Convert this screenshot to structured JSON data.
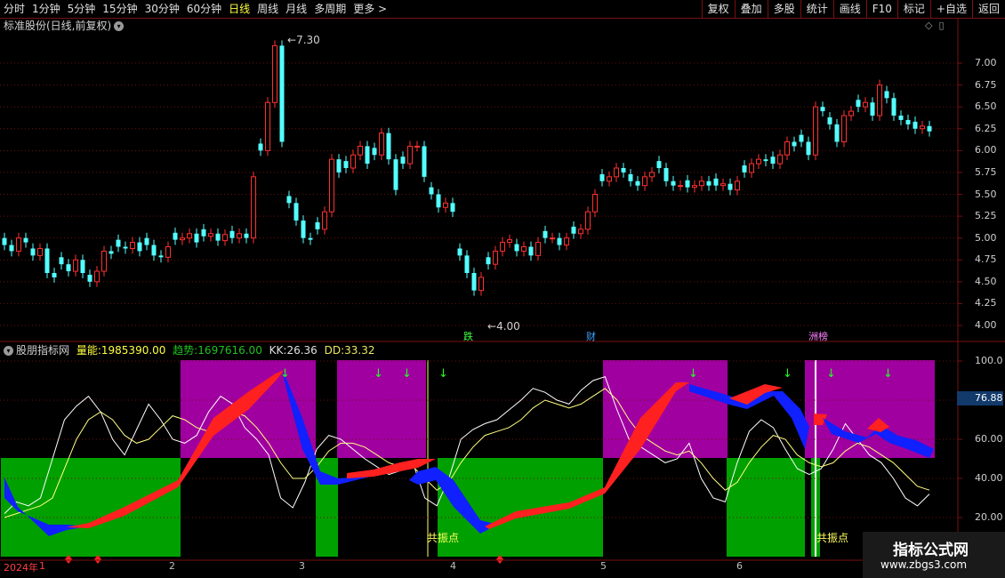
{
  "toolbar": {
    "periods": [
      "分时",
      "1分钟",
      "5分钟",
      "15分钟",
      "30分钟",
      "60分钟",
      "日线",
      "周线",
      "月线",
      "多周期",
      "更多 >"
    ],
    "active_period": "日线",
    "actions": [
      "复权",
      "叠加",
      "多股",
      "统计",
      "画线",
      "F10",
      "标记",
      "+自选",
      "返回"
    ]
  },
  "main_chart": {
    "title": "标准股份(日线,前复权)",
    "price_axis": [
      "7.00",
      "6.75",
      "6.50",
      "6.25",
      "6.00",
      "5.75",
      "5.50",
      "5.25",
      "5.00",
      "4.75",
      "4.50",
      "4.25",
      "4.00"
    ],
    "high_label": "7.30",
    "low_label": "4.00",
    "markers": [
      "跌",
      "财",
      "洲榜"
    ]
  },
  "indicator": {
    "name": "股朋指标网",
    "volume_label": "量能:",
    "volume_value": "1985390.00",
    "trend_label": "趋势:",
    "trend_value": "1697616.00",
    "kk_label": "KK:",
    "kk_value": "26.36",
    "dd_label": "DD:",
    "dd_value": "33.32",
    "axis": [
      "100.0",
      "60.00",
      "40.00",
      "20.00"
    ],
    "current_value": "76.88",
    "resonance_label": "共振点"
  },
  "date_axis": {
    "year": "2024年",
    "months": [
      "1",
      "2",
      "3",
      "4",
      "5",
      "6"
    ]
  },
  "watermark": {
    "title": "指标公式网",
    "url": "www.zbgs3.com"
  },
  "colors": {
    "up": "#ff3030",
    "down": "#54ffff",
    "purple": "#a000a0",
    "green": "#00a000",
    "blue": "#1020ff",
    "red_band": "#ff2020"
  }
}
